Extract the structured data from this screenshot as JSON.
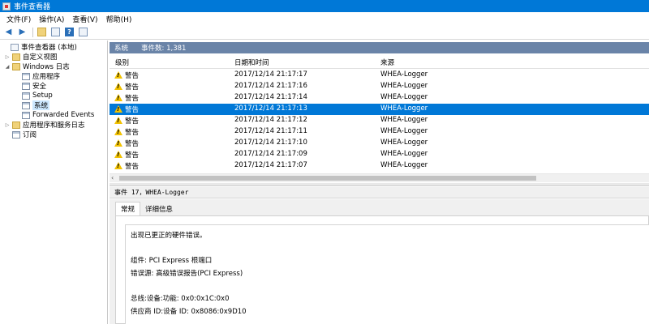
{
  "window": {
    "title": "事件查看器"
  },
  "menu": [
    {
      "label": "文件(F)"
    },
    {
      "label": "操作(A)"
    },
    {
      "label": "查看(V)"
    },
    {
      "label": "帮助(H)"
    }
  ],
  "tree": [
    {
      "label": "事件查看器 (本地)",
      "icon": "event-viewer-icon"
    },
    {
      "label": "自定义视图",
      "icon": "folder-icon"
    },
    {
      "label": "Windows 日志",
      "icon": "folder-icon"
    },
    {
      "label": "应用程序",
      "icon": "log-icon"
    },
    {
      "label": "安全",
      "icon": "log-icon"
    },
    {
      "label": "Setup",
      "icon": "log-icon"
    },
    {
      "label": "系统",
      "icon": "log-icon"
    },
    {
      "label": "Forwarded Events",
      "icon": "log-icon"
    },
    {
      "label": "应用程序和服务日志",
      "icon": "folder-icon"
    },
    {
      "label": "订阅",
      "icon": "subscription-icon"
    }
  ],
  "pane": {
    "log_name": "系统",
    "event_count": "事件数: 1,381",
    "columns": {
      "level": "级别",
      "date": "日期和时间",
      "source": "来源"
    },
    "rows": [
      {
        "level": "警告",
        "date": "2017/12/14 21:17:17",
        "source": "WHEA-Logger"
      },
      {
        "level": "警告",
        "date": "2017/12/14 21:17:16",
        "source": "WHEA-Logger"
      },
      {
        "level": "警告",
        "date": "2017/12/14 21:17:14",
        "source": "WHEA-Logger"
      },
      {
        "level": "警告",
        "date": "2017/12/14 21:17:13",
        "source": "WHEA-Logger"
      },
      {
        "level": "警告",
        "date": "2017/12/14 21:17:12",
        "source": "WHEA-Logger"
      },
      {
        "level": "警告",
        "date": "2017/12/14 21:17:11",
        "source": "WHEA-Logger"
      },
      {
        "level": "警告",
        "date": "2017/12/14 21:17:10",
        "source": "WHEA-Logger"
      },
      {
        "level": "警告",
        "date": "2017/12/14 21:17:09",
        "source": "WHEA-Logger"
      },
      {
        "level": "警告",
        "date": "2017/12/14 21:17:07",
        "source": "WHEA-Logger"
      }
    ]
  },
  "detail": {
    "header": "事件 17，WHEA-Logger",
    "tabs": [
      {
        "label": "常规"
      },
      {
        "label": "详细信息"
      }
    ],
    "lines": [
      "出现已更正的硬件错误。",
      "组件: PCI Express 根端口",
      "错误源: 高级错误报告(PCI Express)",
      "总线:设备:功能: 0x0:0x1C:0x0",
      "供应商 ID:设备 ID: 0x8086:0x9D10"
    ]
  },
  "colors": {
    "titlebar": "#0078d7",
    "selection": "#0078d7",
    "pane_header": "#6a84a8",
    "warning": "#f2c200"
  }
}
